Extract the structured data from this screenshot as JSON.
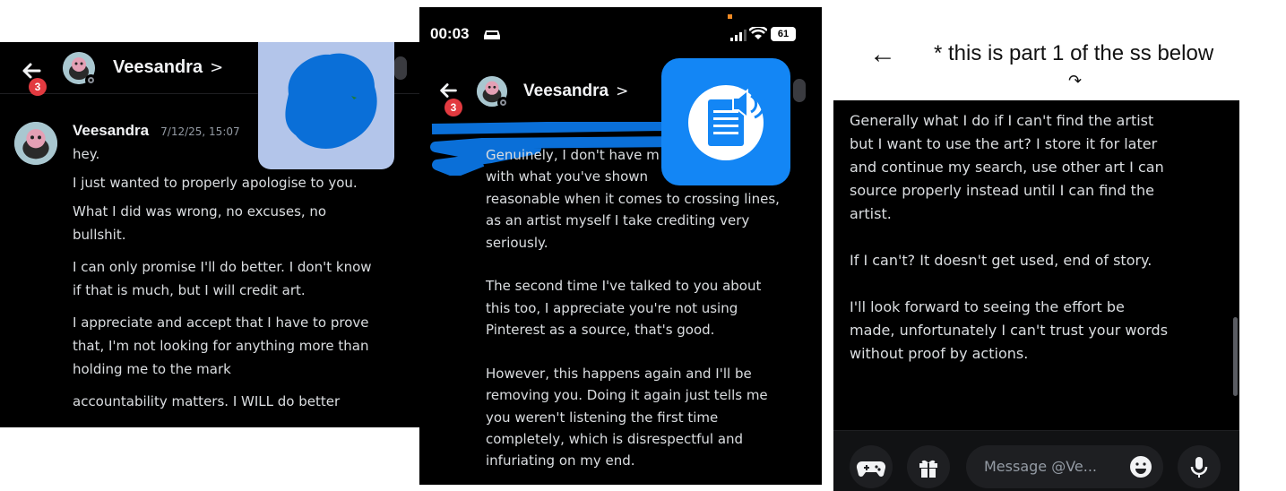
{
  "caption": {
    "arrow": "←",
    "text": "* this is part 1 of the ss below",
    "curve": "↷"
  },
  "panel_left": {
    "header": {
      "badge": "3",
      "name": "Veesandra",
      "chevron": ">"
    },
    "message": {
      "author": "Veesandra",
      "timestamp": "7/12/25, 15:07",
      "lines": [
        "hey.",
        "I just wanted to properly apologise to you.",
        "What I did was wrong, no excuses, no",
        "bullshit.",
        "I can only promise I'll do better. I don't know",
        "if that is much, but I will credit art.",
        "I appreciate and accept that I have to prove",
        "that, I'm not looking for anything more than",
        "holding me to the mark",
        "accountability matters. I WILL do better"
      ]
    }
  },
  "panel_middle": {
    "status_bar": {
      "time": "00:03",
      "battery": "61"
    },
    "header": {
      "badge": "3",
      "name": "Veesandra",
      "chevron": ">"
    },
    "lines": [
      "Genuinely, I don't have m",
      "with what you've shown",
      "reasonable when it comes to crossing lines,",
      "as an artist myself I take crediting very",
      "seriously.",
      "",
      "The second time I've talked to you about",
      "this too, I appreciate you're not using",
      "Pinterest as a source, that's good.",
      "",
      "However, this happens again and I'll be",
      "removing you. Doing it again just tells me",
      "you weren't listening the first time",
      "completely, which is disrespectful and",
      "infuriating on my end."
    ]
  },
  "panel_right": {
    "lines": [
      "Generally what I do if I can't find the artist",
      "but I want to use the art? I store it for later",
      "and continue my search, use other art I can",
      "source properly instead until I can find the",
      "artist.",
      "",
      "If I can't? It doesn't get used, end of story.",
      "",
      "I'll look forward to seeing the effort be",
      "made, unfortunately I can't trust your words",
      "without proof by actions."
    ],
    "composer": {
      "placeholder": "Message @Ve..."
    }
  },
  "colors": {
    "panel_bg": "#000000",
    "text": "#dbdee1",
    "badge": "#e23a40",
    "blob": "#0a6fd8",
    "blob_bg": "#b3c5ea",
    "doc_icon_bg": "#1386f5"
  },
  "icons": [
    "back-arrow-icon",
    "gamepad-icon",
    "gift-icon",
    "emoji-icon",
    "microphone-icon",
    "document-speaker-icon",
    "wifi-icon",
    "signal-icon",
    "car-icon"
  ]
}
